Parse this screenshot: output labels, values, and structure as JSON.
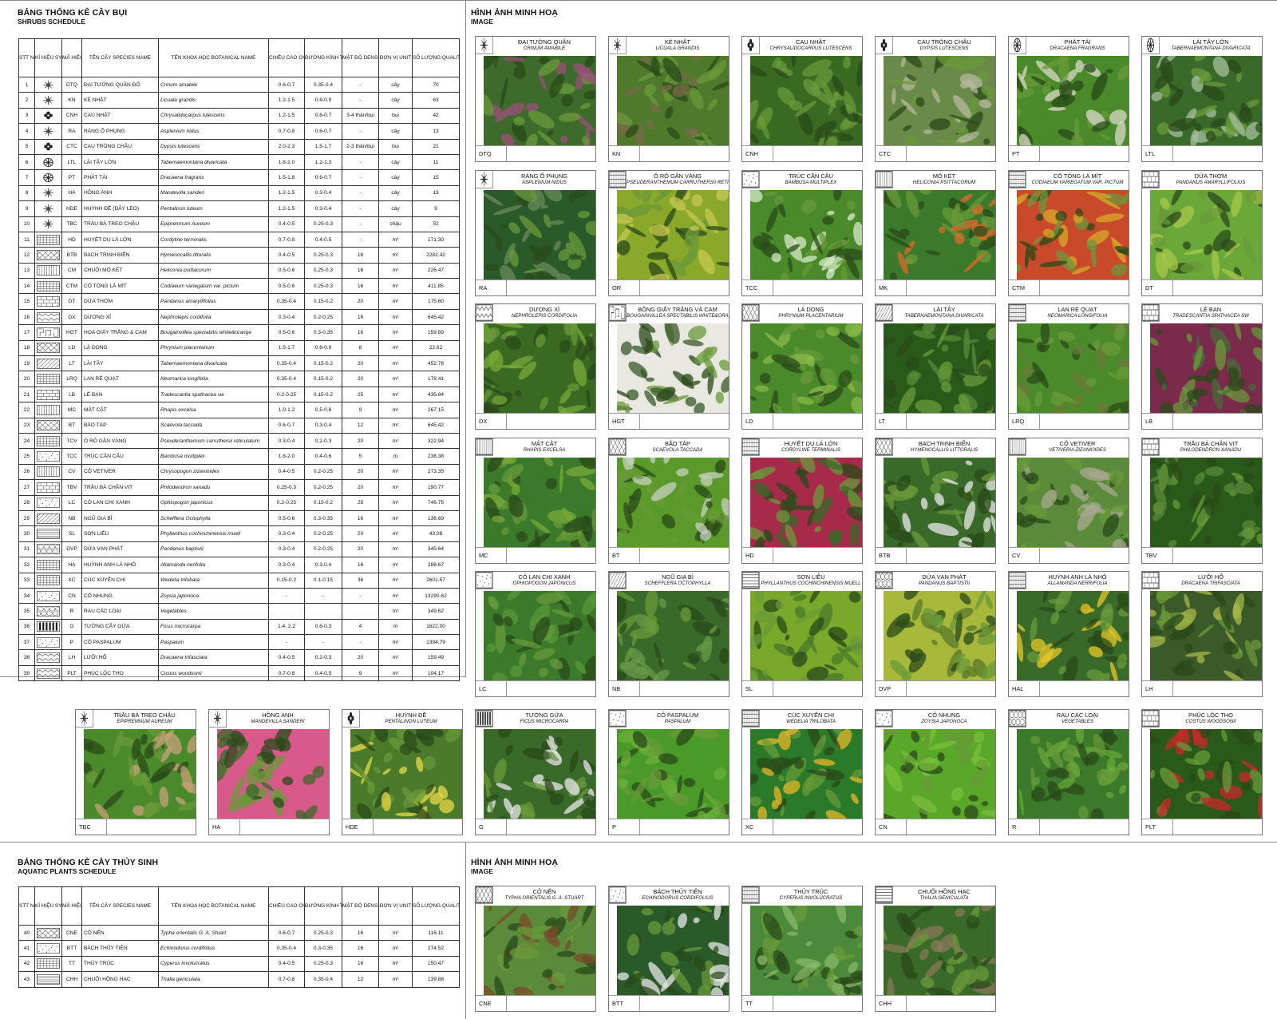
{
  "shrubs": {
    "title": "BẢNG THỐNG KÊ CÂY BỤI",
    "subtitle": "SHRUBS SCHEDULE",
    "headers": {
      "stt": "STT No.",
      "symbol": "KÍ HIỆU SYMBOL",
      "code": "MÃ HIỆU CODE",
      "species": "TÊN CÂY SPECIES NAME",
      "botanical": "TÊN KHOA HỌC BOTANICAL NAME",
      "height": "CHIỀU CAO OVERALL (m)",
      "spread": "ĐƯỜNG KÍNH TÁN SPREAD (m)",
      "density": "MẬT ĐỘ DENSITY (cây/m²)",
      "unit": "ĐƠN VỊ UNIT",
      "quality": "SỐ LƯỢNG QUALITY"
    },
    "rows": [
      {
        "no": "1",
        "code": "DTQ",
        "name": "ĐẠI TƯỚNG QUÂN ĐỎ",
        "bot": "Crinum amabile",
        "h": "0.6-0.7",
        "s": "0.35-0.4",
        "d": "-",
        "u": "cây",
        "q": "70",
        "sym": "star"
      },
      {
        "no": "2",
        "code": "KN",
        "name": "KÈ NHẬT",
        "bot": "Licuala grandis",
        "h": "1.2-1.5",
        "s": "0.8-0.9",
        "d": "-",
        "u": "cây",
        "q": "63",
        "sym": "star"
      },
      {
        "no": "3",
        "code": "CNH",
        "name": "CAU NHẬT",
        "bot": "Chrysalidocarpus lutescens",
        "h": "1.2-1.5",
        "s": "0.6-0.7",
        "d": "3-4 thân/bụi",
        "u": "bụi",
        "q": "42",
        "sym": "flower"
      },
      {
        "no": "4",
        "code": "RA",
        "name": "RÁNG Ổ PHỤNG",
        "bot": "Asplenium nidus",
        "h": "0.7-0.8",
        "s": "0.6-0.7",
        "d": "-",
        "u": "cây",
        "q": "13",
        "sym": "star"
      },
      {
        "no": "5",
        "code": "CTC",
        "name": "CAU TRÒNG CHẬU",
        "bot": "Dypsis lutescens",
        "h": "2.0-2.3",
        "s": "1.5-1.7",
        "d": "2-3 thân/bụi",
        "u": "bụi",
        "q": "21",
        "sym": "flower"
      },
      {
        "no": "6",
        "code": "LTL",
        "name": "LÀI TÂY LỚN",
        "bot": "Tabernaemontana divaricata",
        "h": "1.8-2.0",
        "s": "1.2-1.3",
        "d": "-",
        "u": "cây",
        "q": "11",
        "sym": "wheel"
      },
      {
        "no": "7",
        "code": "PT",
        "name": "PHÁT TÀI",
        "bot": "Dracaena fragrans",
        "h": "1.5-1.8",
        "s": "0.6-0.7",
        "d": "-",
        "u": "cây",
        "q": "15",
        "sym": "wheel"
      },
      {
        "no": "8",
        "code": "HA",
        "name": "HỒNG ANH",
        "bot": "Mandevilla sanderi",
        "h": "1.2-1.5",
        "s": "0.3-0.4",
        "d": "-",
        "u": "cây",
        "q": "13",
        "sym": "star"
      },
      {
        "no": "9",
        "code": "HDE",
        "name": "HUỲNH ĐỀ (DÂY LEO)",
        "bot": "Pentalinon luteum",
        "h": "1.2-1.5",
        "s": "0.3-0.4",
        "d": "-",
        "u": "cây",
        "q": "9",
        "sym": "star"
      },
      {
        "no": "10",
        "code": "TBC",
        "name": "TRẦU BÀ TREO CHẬU",
        "bot": "Epipremnum Aureum",
        "h": "0.4-0.5",
        "s": "0.25-0.3",
        "d": "-",
        "u": "chậu",
        "q": "52",
        "sym": "star"
      },
      {
        "no": "11",
        "code": "HD",
        "name": "HUYẾT DỤ LÁ LỚN",
        "bot": "Cordyline terminalis",
        "h": "0.7-0.8",
        "s": "0.4-0.5",
        "d": "-",
        "u": "m²",
        "q": "171.30",
        "sym": "grid"
      },
      {
        "no": "12",
        "code": "BTB",
        "name": "BẠCH TRINH BIỂN",
        "bot": "Hymenocallis littoralis",
        "h": "0.4-0.5",
        "s": "0.25-0.3",
        "d": "16",
        "u": "m²",
        "q": "2282.42",
        "sym": "cross"
      },
      {
        "no": "13",
        "code": "CM",
        "name": "CHUỐI MỎ KÉT",
        "bot": "Heliconia psittacorum",
        "h": "0.5-0.6",
        "s": "0.25-0.3",
        "d": "16",
        "u": "m²",
        "q": "226.47",
        "sym": "vlines"
      },
      {
        "no": "14",
        "code": "CTM",
        "name": "CÔ TÒNG LÁ MÍT",
        "bot": "Codiaeum variegatum var. pictum",
        "h": "0.5-0.6",
        "s": "0.25-0.3",
        "d": "16",
        "u": "m²",
        "q": "411.85",
        "sym": "grid"
      },
      {
        "no": "15",
        "code": "DT",
        "name": "DỨA THƠM",
        "bot": "Pandanus amaryllifolius",
        "h": "0.35-0.4",
        "s": "0.15-0.2",
        "d": "20",
        "u": "m²",
        "q": "175.60",
        "sym": "brick"
      },
      {
        "no": "16",
        "code": "DX",
        "name": "DƯƠNG XỈ",
        "bot": "Nephrolepis cordifolia",
        "h": "0.3-0.4",
        "s": "0.2-0.25",
        "d": "16",
        "u": "m²",
        "q": "645.42",
        "sym": "zig"
      },
      {
        "no": "17",
        "code": "HGT",
        "name": "HOA GIẤY TRẮNG & CAM",
        "bot": "Bougainvillea spectabilis white&orange",
        "h": "0.5-0.6",
        "s": "0.3-0.35",
        "d": "16",
        "u": "m²",
        "q": "159.89",
        "sym": "maze"
      },
      {
        "no": "18",
        "code": "LD",
        "name": "LÁ DONG",
        "bot": "Phrynium placentarium",
        "h": "1.5-1.7",
        "s": "0.8-0.9",
        "d": "8",
        "u": "m²",
        "q": "22.62",
        "sym": "cross"
      },
      {
        "no": "19",
        "code": "LT",
        "name": "LÀI TÂY",
        "bot": "Tabernaemontana divaricata",
        "h": "0.35-0.4",
        "s": "0.15-0.2",
        "d": "20",
        "u": "m²",
        "q": "452.78",
        "sym": "diag"
      },
      {
        "no": "20",
        "code": "LRQ",
        "name": "LAN RẺ QUẠT",
        "bot": "Neomarica longifolia",
        "h": "0.35-0.4",
        "s": "0.15-0.2",
        "d": "20",
        "u": "m²",
        "q": "178.41",
        "sym": "grid"
      },
      {
        "no": "21",
        "code": "LB",
        "name": "LẺ BẠN",
        "bot": "Tradescantia spathacea sw",
        "h": "0.2-0.25",
        "s": "0.15-0.2",
        "d": "25",
        "u": "m²",
        "q": "435.84",
        "sym": "brick"
      },
      {
        "no": "22",
        "code": "MC",
        "name": "MẬT CẬT",
        "bot": "Rhapis excelsa",
        "h": "1.0-1.2",
        "s": "0.5-0.6",
        "d": "9",
        "u": "m²",
        "q": "267.15",
        "sym": "vlines"
      },
      {
        "no": "23",
        "code": "BT",
        "name": "BÃO TÁP",
        "bot": "Scaevola taccada",
        "h": "0.6-0.7",
        "s": "0.3-0.4",
        "d": "12",
        "u": "m²",
        "q": "645.42",
        "sym": "cross"
      },
      {
        "no": "24",
        "code": "TCV",
        "name": "Ô RÔ GÂN VÀNG",
        "bot": "Pseuderanthemum carruthersii reticulatum",
        "h": "0.3-0.4",
        "s": "0.2-0.3",
        "d": "20",
        "u": "m²",
        "q": "322.94",
        "sym": "grid"
      },
      {
        "no": "25",
        "code": "TCC",
        "name": "TRÚC CẦN CÂU",
        "bot": "Bambusa multiplex",
        "h": "1.8-2.0",
        "s": "0.4-0.6",
        "d": "5",
        "u": "m",
        "q": "238.38",
        "sym": "dots"
      },
      {
        "no": "26",
        "code": "CV",
        "name": "CỎ VETIVER",
        "bot": "Chrysopogon zizanioides",
        "h": "0.4-0.5",
        "s": "0.2-0.25",
        "d": "20",
        "u": "m²",
        "q": "273.35",
        "sym": "vlines"
      },
      {
        "no": "27",
        "code": "TBV",
        "name": "TRẦU BÀ CHÂN VỊT",
        "bot": "Philodendron xanadu",
        "h": "0.25-0.3",
        "s": "0.2-0.25",
        "d": "20",
        "u": "m²",
        "q": "190.77",
        "sym": "brick"
      },
      {
        "no": "28",
        "code": "LC",
        "name": "CỎ LAN CHI XANH",
        "bot": "Ophiopogon japonicus",
        "h": "0.2-0.25",
        "s": "0.15-0.2",
        "d": "25",
        "u": "m²",
        "q": "746.75",
        "sym": "dots"
      },
      {
        "no": "29",
        "code": "NB",
        "name": "NGŨ GIA BÌ",
        "bot": "Schefflera Octophylla",
        "h": "0.5-0.6",
        "s": "0.3-0.35",
        "d": "16",
        "u": "m²",
        "q": "138.69",
        "sym": "diag"
      },
      {
        "no": "30",
        "code": "SL",
        "name": "SƠN LIỄU",
        "bot": "Phyllanthus cochinchinensis muell",
        "h": "0.3-0.4",
        "s": "0.2-0.25",
        "d": "20",
        "u": "m²",
        "q": "43.08",
        "sym": "hlines"
      },
      {
        "no": "31",
        "code": "DVP",
        "name": "DỨA VẠN PHÁT",
        "bot": "Pandanus baptistii",
        "h": "0.3-0.4",
        "s": "0.2-0.25",
        "d": "20",
        "u": "m²",
        "q": "345.64",
        "sym": "scale"
      },
      {
        "no": "32",
        "code": "HA",
        "name": "HUỲNH ANH LÁ NHỎ",
        "bot": "Allamanda nerifolia",
        "h": "0.3-0.4",
        "s": "0.3-0.4",
        "d": "16",
        "u": "m²",
        "q": "288.67",
        "sym": "grid"
      },
      {
        "no": "33",
        "code": "XC",
        "name": "CÚC XUYẾN CHI",
        "bot": "Wedelia trilobata",
        "h": "0.15-0.2",
        "s": "0.1-0.15",
        "d": "36",
        "u": "m²",
        "q": "2601.57",
        "sym": "grid"
      },
      {
        "no": "34",
        "code": "CN",
        "name": "CỎ NHUNG",
        "bot": "Zoysia japonoca",
        "h": "-",
        "s": "-",
        "d": "-",
        "u": "m²",
        "q": "13290.62",
        "sym": "dots"
      },
      {
        "no": "35",
        "code": "R",
        "name": "RAU CÁC LOẠI",
        "bot": "Vegetables",
        "h": "",
        "s": "",
        "d": "",
        "u": "m²",
        "q": "349.62",
        "sym": "scale"
      },
      {
        "no": "36",
        "code": "G",
        "name": "TƯỜNG CÂY GỪA",
        "bot": "Ficus microcarpa",
        "h": "1.4; 2.2",
        "s": "0.6-0.3",
        "d": "4",
        "u": "m",
        "q": "1622.00",
        "sym": "bars"
      },
      {
        "no": "37",
        "code": "P",
        "name": "CỎ PASPALUM",
        "bot": "Paspalum",
        "h": "-",
        "s": "-",
        "d": "-",
        "u": "m²",
        "q": "1394.79",
        "sym": "dots"
      },
      {
        "no": "38",
        "code": "LH",
        "name": "LƯỠI HỔ",
        "bot": "Dracaena trifasciata",
        "h": "0.4-0.5",
        "s": "0.2-0.3",
        "d": "20",
        "u": "m²",
        "q": "159.49",
        "sym": "zig"
      },
      {
        "no": "39",
        "code": "PLT",
        "name": "PHÚC LỘC THỌ",
        "bot": "Costus woodsonii",
        "h": "0.7-0.8",
        "s": "0.4-0.5",
        "d": "9",
        "u": "m²",
        "q": "104.17",
        "sym": "zig"
      }
    ]
  },
  "shrub_images": {
    "title": "HÌNH ẢNH MINH HOẠ",
    "subtitle": "IMAGE",
    "cards": [
      {
        "vn": "ĐẠI TƯỚNG QUÂN",
        "sci": "CRINUM AMABILE",
        "code": "DTQ",
        "sym": "star",
        "c1": "#3d6b2c",
        "c2": "#9a4f7a"
      },
      {
        "vn": "KÈ NHẬT",
        "sci": "LICUALA GRANDIS",
        "code": "KN",
        "sym": "star",
        "c1": "#4f7a2c",
        "c2": "#7a6a4a"
      },
      {
        "vn": "CAU NHẬT",
        "sci": "CHRYSALIDOCARPUS LUTESCENS",
        "code": "CNH",
        "sym": "flower",
        "c1": "#3a6a22",
        "c2": "#6a9a3a"
      },
      {
        "vn": "CAU TRÒNG CHẬU",
        "sci": "DYPSIS LUTESCENS",
        "code": "CTC",
        "sym": "flower",
        "c1": "#6a8a4a",
        "c2": "#b8b8a0"
      },
      {
        "vn": "PHÁT TÀI",
        "sci": "DRACAENA FRAGRANS",
        "code": "PT",
        "sym": "wheel",
        "c1": "#4a8a2a",
        "c2": "#d8d8c8"
      },
      {
        "vn": "LÀI TÂY LỚN",
        "sci": "TABERNAEMONTANA DIVARICATA",
        "code": "LTL",
        "sym": "wheel",
        "c1": "#3a6a2a",
        "c2": "#a8c0a0"
      },
      {
        "vn": "RÁNG Ổ PHỤNG",
        "sci": "ASPLENIUM NIDUS",
        "code": "RA",
        "sym": "star",
        "c1": "#2a5a2a",
        "c2": "#6a8a5a"
      },
      {
        "vn": "Ô RÔ GÂN VÀNG",
        "sci": "PSEUDERANTHEMUM CARRUTHERSII RETICULATUM",
        "code": "OR",
        "sym": "grid",
        "c1": "#8aa82a",
        "c2": "#c8c850"
      },
      {
        "vn": "TRÚC CẦN CÂU",
        "sci": "BAMBUSA MULTIPLEX",
        "code": "TCC",
        "sym": "dots",
        "c1": "#4a8a2a",
        "c2": "#d8e8c8"
      },
      {
        "vn": "MỎ KÉT",
        "sci": "HELICONIA PSITTACORUM",
        "code": "MK",
        "sym": "vlines",
        "c1": "#3a7a2a",
        "c2": "#e06a2a"
      },
      {
        "vn": "CÔ TÒNG LÁ MÍT",
        "sci": "CODIAEUM VARIEGATUM VAR. PICTUM",
        "code": "CTM",
        "sym": "grid",
        "c1": "#c84a2a",
        "c2": "#d8a82a"
      },
      {
        "vn": "DỨA THƠM",
        "sci": "PANDANUS AMARYLLIFOLIUS",
        "code": "DT",
        "sym": "brick",
        "c1": "#6aa83a",
        "c2": "#a8c84a"
      },
      {
        "vn": "DƯƠNG XỈ",
        "sci": "NEPHROLEPIS CORDIFOLIA",
        "code": "DX",
        "sym": "zig",
        "c1": "#3a6a22",
        "c2": "#7aaa3a"
      },
      {
        "vn": "BÔNG GIẤY TRẮNG VÀ CAM",
        "sci": "BOUGAINVILLEA SPECTABILIS WHITE&ORANGE",
        "code": "HGT",
        "sym": "maze",
        "c1": "#e8e8e0",
        "c2": "#3a5a2a"
      },
      {
        "vn": "LÁ DONG",
        "sci": "PHRYNIUM PLACENTARIUM",
        "code": "LD",
        "sym": "cross",
        "c1": "#4a8a2a",
        "c2": "#8ab84a"
      },
      {
        "vn": "LÀI TÂY",
        "sci": "TABERNAEMONTANA DIVARICATA",
        "code": "LT",
        "sym": "diag",
        "c1": "#2a5a1a",
        "c2": "#5a8a3a"
      },
      {
        "vn": "LAN RẺ QUẠT",
        "sci": "NEOMARICA LONGIFOLIA",
        "code": "LRQ",
        "sym": "grid",
        "c1": "#4a8a2a",
        "c2": "#6a7a3a"
      },
      {
        "vn": "LẺ BẠN",
        "sci": "TRADESCANTIA SPATHACEA SW",
        "code": "LB",
        "sym": "brick",
        "c1": "#7a2a4a",
        "c2": "#4a6a3a"
      },
      {
        "vn": "MẬT CẬT",
        "sci": "RHAPIS EXCELSA",
        "code": "MC",
        "sym": "vlines",
        "c1": "#3a7a2a",
        "c2": "#7aaa3a"
      },
      {
        "vn": "BÃO TÁP",
        "sci": "SCAEVOLA TACCADA",
        "code": "BT",
        "sym": "cross",
        "c1": "#5a9a2a",
        "c2": "#c8d0c0"
      },
      {
        "vn": "HUYẾT DỤ LÁ LỚN",
        "sci": "CORDYLINE TERMINALIS",
        "code": "HD",
        "sym": "grid",
        "c1": "#a82a4a",
        "c2": "#3a6a2a"
      },
      {
        "vn": "BẠCH TRINH BIỂN",
        "sci": "HYMENOCALLIS LITTORALIS",
        "code": "BTB",
        "sym": "cross",
        "c1": "#3a6a2a",
        "c2": "#e8e8e8"
      },
      {
        "vn": "CỎ VETIVER",
        "sci": "VETIVERIA ZIZANIOIDES",
        "code": "CV",
        "sym": "vlines",
        "c1": "#5a8a3a",
        "c2": "#a8a890"
      },
      {
        "vn": "TRẦU BÀ CHÂN VỊT",
        "sci": "PHILODENDRON XANADU",
        "code": "TBV",
        "sym": "brick",
        "c1": "#2a5a1a",
        "c2": "#5a8a3a"
      },
      {
        "vn": "CỎ LAN CHI XANH",
        "sci": "OPHIOPOGON JAPONICUS",
        "code": "LC",
        "sym": "dots",
        "c1": "#3a7a2a",
        "c2": "#5a9a3a"
      },
      {
        "vn": "NGŨ GIA BÌ",
        "sci": "SCHEFFLERA OCTOPHYLLA",
        "code": "NB",
        "sym": "diag",
        "c1": "#3a6a2a",
        "c2": "#6a9a4a"
      },
      {
        "vn": "SƠN LIỄU",
        "sci": "PHYLLANTHUS COCHINCHINENSIS MUELL",
        "code": "SL",
        "sym": "hlines",
        "c1": "#7aa82a",
        "c2": "#4a7a2a",
        "wrap": true
      },
      {
        "vn": "DỨA VẠN PHÁT",
        "sci": "PANDANUS BAPTISTII",
        "code": "DVP",
        "sym": "scale",
        "c1": "#a8b83a",
        "c2": "#5a7a2a"
      },
      {
        "vn": "HUỲNH ANH LÁ NHỎ",
        "sci": "ALLAMANDA NERRIFOLIA",
        "code": "HAL",
        "sym": "grid",
        "c1": "#3a6a2a",
        "c2": "#e8c82a"
      },
      {
        "vn": "LƯỠI HỔ",
        "sci": "DRACAENA TRIFASCIATA",
        "code": "LH",
        "sym": "brick",
        "c1": "#3a5a2a",
        "c2": "#a8b84a"
      }
    ]
  },
  "bottom_cards": [
    {
      "vn": "TRẦU BÀ TREO CHẬU",
      "sci": "EPIPREMNUM AUREUM",
      "code": "TBC",
      "sym": "star",
      "c1": "#4a8a2a",
      "c2": "#c8a07a"
    },
    {
      "vn": "HỒNG ANH",
      "sci": "MANDEVILLA SANDERI",
      "code": "HA",
      "sym": "star",
      "c1": "#d85a8a",
      "c2": "#3a6a2a"
    },
    {
      "vn": "HUỲNH ĐỀ",
      "sci": "PENTALINON LUTEUM",
      "code": "HDE",
      "sym": "flower",
      "c1": "#4a7a2a",
      "c2": "#e8d84a"
    },
    {
      "vn": "TƯỜNG GỪA",
      "sci": "FICUS MICROCARPA",
      "code": "G",
      "sym": "bars",
      "c1": "#3a6a2a",
      "c2": "#e8e8e8"
    },
    {
      "vn": "CỎ PASPALUM",
      "sci": "PASPALUM",
      "code": "P",
      "sym": "dots",
      "c1": "#4a9a2a",
      "c2": "#6ab03a"
    },
    {
      "vn": "CÚC XUYẾN CHI",
      "sci": "WEDELIA TRILOBATA",
      "code": "XC",
      "sym": "grid",
      "c1": "#2a7a2a",
      "c2": "#e8b82a"
    },
    {
      "vn": "CỎ NHUNG",
      "sci": "ZOYSIA JAPONOCA",
      "code": "CN",
      "sym": "dots",
      "c1": "#5aa82a",
      "c2": "#7ac03a"
    },
    {
      "vn": "RAU CÁC LOẠI",
      "sci": "VEGETABLES",
      "code": "R",
      "sym": "scale",
      "c1": "#3a7a2a",
      "c2": "#6aa83a"
    },
    {
      "vn": "PHÚC LỘC THỌ",
      "sci": "COSTUS WOODSONII",
      "code": "PLT",
      "sym": "brick",
      "c1": "#2a5a1a",
      "c2": "#c82a2a"
    }
  ],
  "aquatic": {
    "title": "BẢNG THỐNG KÊ CÂY THỦY SINH",
    "subtitle": "AQUATIC PLANTS SCHEDULE",
    "rows": [
      {
        "no": "40",
        "code": "CNE",
        "name": "CỎ NẾN",
        "bot": "Typha orientalis G. A. Stuart",
        "h": "0.6-0.7",
        "s": "0.25-0.3",
        "d": "16",
        "u": "m²",
        "q": "116.11",
        "sym": "cross"
      },
      {
        "no": "41",
        "code": "BTT",
        "name": "BÁCH THỦY TIÊN",
        "bot": "Echinodorus cordifolius",
        "h": "0.35-0.4",
        "s": "0.3-0.35",
        "d": "16",
        "u": "m²",
        "q": "274.52",
        "sym": "dots"
      },
      {
        "no": "42",
        "code": "TT",
        "name": "THỦY TRÚC",
        "bot": "Cyperus involucratus",
        "h": "0.4-0.5",
        "s": "0.25-0.3",
        "d": "16",
        "u": "m²",
        "q": "150.47",
        "sym": "grid"
      },
      {
        "no": "43",
        "code": "CHH",
        "name": "CHUỐI HỒNG HẠC",
        "bot": "Thalia geniculata",
        "h": "0.7-0.8",
        "s": "0.35-0.4",
        "d": "12",
        "u": "m²",
        "q": "139.88",
        "sym": "hlines"
      }
    ]
  },
  "aquatic_images": {
    "title": "HÌNH ẢNH MINH HOẠ",
    "subtitle": "IMAGE",
    "cards": [
      {
        "vn": "CỎ NẾN",
        "sci": "TYPHA ORIENTALIS G. A. STUART",
        "code": "CNE",
        "sym": "cross",
        "c1": "#5a8a3a",
        "c2": "#7a4a2a"
      },
      {
        "vn": "BÁCH THỦY TIÊN",
        "sci": "ECHINODORUS CORDIFOLIUS",
        "code": "BTT",
        "sym": "dots",
        "c1": "#2a5a2a",
        "c2": "#e8e8e8"
      },
      {
        "vn": "THỦY TRÚC",
        "sci": "CYPERUS INVOLUCRATUS",
        "code": "TT",
        "sym": "grid",
        "c1": "#4a8a3a",
        "c2": "#8ab86a"
      },
      {
        "vn": "CHUỐI HỒNG HẠC",
        "sci": "THALIA GENICULATA",
        "code": "CHH",
        "sym": "hlines",
        "c1": "#3a6a2a",
        "c2": "#8a7a5a"
      }
    ]
  }
}
